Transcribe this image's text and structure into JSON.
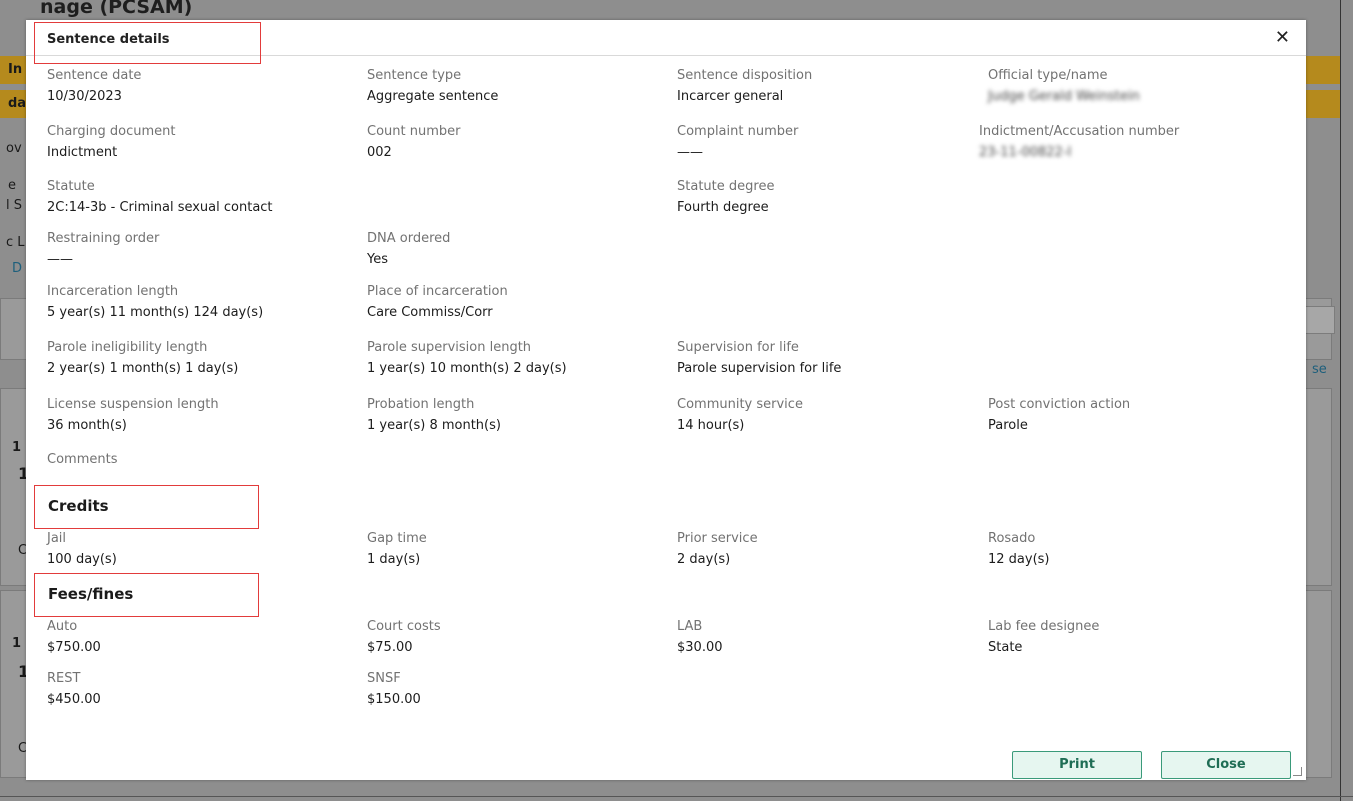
{
  "background": {
    "page_title": "nage (PCSAM)",
    "fragments": [
      "In",
      "da",
      "ov",
      "e",
      "l S",
      "c L",
      "D",
      "se",
      "1",
      "1",
      "C",
      "1",
      "1",
      "C"
    ]
  },
  "dialog": {
    "title": "Sentence details",
    "close_icon": "close-icon",
    "fields": [
      {
        "label": "Sentence date",
        "value": "10/30/2023"
      },
      {
        "label": "Sentence type",
        "value": "Aggregate sentence"
      },
      {
        "label": "Sentence disposition",
        "value": "Incarcer general"
      },
      {
        "label": "Official type/name",
        "value": "Judge Gerald Weinstein"
      },
      {
        "label": "Charging document",
        "value": "Indictment"
      },
      {
        "label": "Count number",
        "value": "002"
      },
      {
        "label": "Complaint number",
        "value": "——"
      },
      {
        "label": "Indictment/Accusation number",
        "value": "23-11-00822-I"
      },
      {
        "label": "Statute",
        "value": "2C:14-3b - Criminal sexual contact"
      },
      {
        "label": "Statute degree",
        "value": "Fourth degree"
      },
      {
        "label": "Restraining order",
        "value": "——"
      },
      {
        "label": "DNA ordered",
        "value": "Yes"
      },
      {
        "label": "Incarceration length",
        "value": "5 year(s) 11 month(s) 124 day(s)"
      },
      {
        "label": "Place of incarceration",
        "value": "Care Commiss/Corr"
      },
      {
        "label": "Parole ineligibility length",
        "value": "2 year(s) 1 month(s) 1 day(s)"
      },
      {
        "label": "Parole supervision length",
        "value": "1 year(s) 10 month(s) 2 day(s)"
      },
      {
        "label": "Supervision for life",
        "value": "Parole supervision for life"
      },
      {
        "label": "License suspension length",
        "value": "36 month(s)"
      },
      {
        "label": "Probation length",
        "value": "1 year(s) 8 month(s)"
      },
      {
        "label": "Community service",
        "value": "14 hour(s)"
      },
      {
        "label": "Post conviction action",
        "value": "Parole"
      },
      {
        "label": "Comments",
        "value": ""
      }
    ],
    "credits": {
      "heading": "Credits",
      "fields": [
        {
          "label": "Jail",
          "value": "100 day(s)"
        },
        {
          "label": "Gap time",
          "value": "1 day(s)"
        },
        {
          "label": "Prior service",
          "value": "2 day(s)"
        },
        {
          "label": "Rosado",
          "value": "12 day(s)"
        }
      ]
    },
    "fees": {
      "heading": "Fees/fines",
      "fields": [
        {
          "label": "Auto",
          "value": "$750.00"
        },
        {
          "label": "Court costs",
          "value": "$75.00"
        },
        {
          "label": "LAB",
          "value": "$30.00"
        },
        {
          "label": "Lab fee designee",
          "value": "State"
        },
        {
          "label": "REST",
          "value": "$450.00"
        },
        {
          "label": "SNSF",
          "value": "$150.00"
        }
      ]
    },
    "buttons": {
      "print": "Print",
      "close": "Close"
    }
  },
  "colors": {
    "accent_border": "#3a9a7a",
    "accent_fill": "#e6f6f0",
    "highlight_box": "#e23b3b",
    "overlay": "#8e8e8e"
  }
}
